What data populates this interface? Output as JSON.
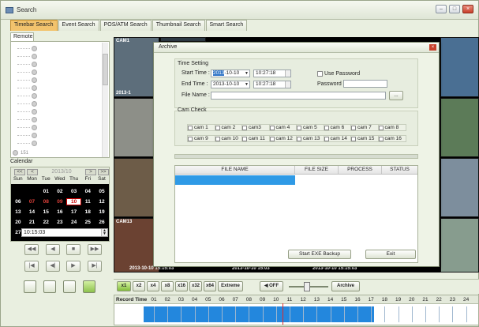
{
  "window": {
    "title": "Search",
    "controls": {
      "minimize": "–",
      "maximize": "□",
      "close": "×"
    }
  },
  "tabs": [
    {
      "label": "Timebar Search",
      "active": true
    },
    {
      "label": "Event Search"
    },
    {
      "label": "POS/ATM Search"
    },
    {
      "label": "Thumbnail Search"
    },
    {
      "label": "Smart Search"
    }
  ],
  "remote": {
    "tab_label": "Remote",
    "list_bottom_label": "151"
  },
  "calendar": {
    "label": "Calendar",
    "month_label": "2013/10",
    "nav": [
      "<<",
      "<",
      ">",
      ">>"
    ],
    "weekdays": [
      "Sun",
      "Mon",
      "Tue",
      "Wed",
      "Thu",
      "Fri",
      "Sat"
    ],
    "weeks": [
      [
        "",
        "",
        "01",
        "02",
        "03",
        "04",
        "05"
      ],
      [
        "06",
        "07",
        "08",
        "09",
        "10",
        "11",
        "12"
      ],
      [
        "13",
        "14",
        "15",
        "16",
        "17",
        "18",
        "19"
      ],
      [
        "20",
        "21",
        "22",
        "23",
        "24",
        "25",
        "26"
      ],
      [
        "27",
        "28",
        "29",
        "30",
        "31",
        "",
        ""
      ]
    ],
    "selected": "10",
    "red_days": [
      "07",
      "08",
      "09"
    ]
  },
  "playback_time": "10:15:03",
  "video_cells": [
    {
      "label": "CAM1",
      "timestamp": "2013-1"
    },
    {
      "label": "CAM2"
    },
    {
      "label": "CAM13",
      "timestamp": "2013-10-10 15:15:03"
    },
    {
      "label": "",
      "timestamp": "2013-10-10 15:03"
    },
    {
      "label": "",
      "timestamp": "2013-10-10 15:15:03"
    }
  ],
  "archive": {
    "title": "Archive",
    "time_setting": {
      "label": "Time Setting",
      "start_label": "Start Time :",
      "start_date": "2013-10-10",
      "start_date_highlight": "2013",
      "start_time": "10:27:18",
      "end_label": "End Time :",
      "end_date": "2013-10-10",
      "end_time": "10:27:18",
      "file_name_label": "File Name :",
      "file_name_value": "",
      "browse_label": "...",
      "use_password_label": "Use Password",
      "password_label": "Password"
    },
    "cam_check": {
      "label": "Cam Check",
      "cams": [
        "cam 1",
        "cam 2",
        "cam3",
        "cam 4",
        "cam 5",
        "cam 6",
        "cam 7",
        "cam 8",
        "cam 9",
        "cam 10",
        "cam 11",
        "cam 12",
        "cam 13",
        "cam 14",
        "cam 15",
        "cam 16"
      ]
    },
    "table": {
      "columns": [
        "FILE NAME",
        "FILE SIZE",
        "PROCESS",
        "STATUS"
      ]
    },
    "buttons": {
      "start": "Start EXE Backup",
      "exit": "Exit"
    }
  },
  "playbar": {
    "speeds": [
      "x1",
      "x2",
      "x4",
      "x8",
      "x16",
      "x32",
      "x64",
      "Extreme"
    ],
    "active_speed": "x1",
    "audio_label": "OFF",
    "archive_label": "Archive"
  },
  "timeline": {
    "label": "Record Time",
    "hours": [
      "01",
      "02",
      "03",
      "04",
      "05",
      "06",
      "07",
      "08",
      "09",
      "10",
      "11",
      "12",
      "13",
      "14",
      "15",
      "16",
      "17",
      "18",
      "19",
      "20",
      "21",
      "22",
      "23",
      "24"
    ]
  }
}
